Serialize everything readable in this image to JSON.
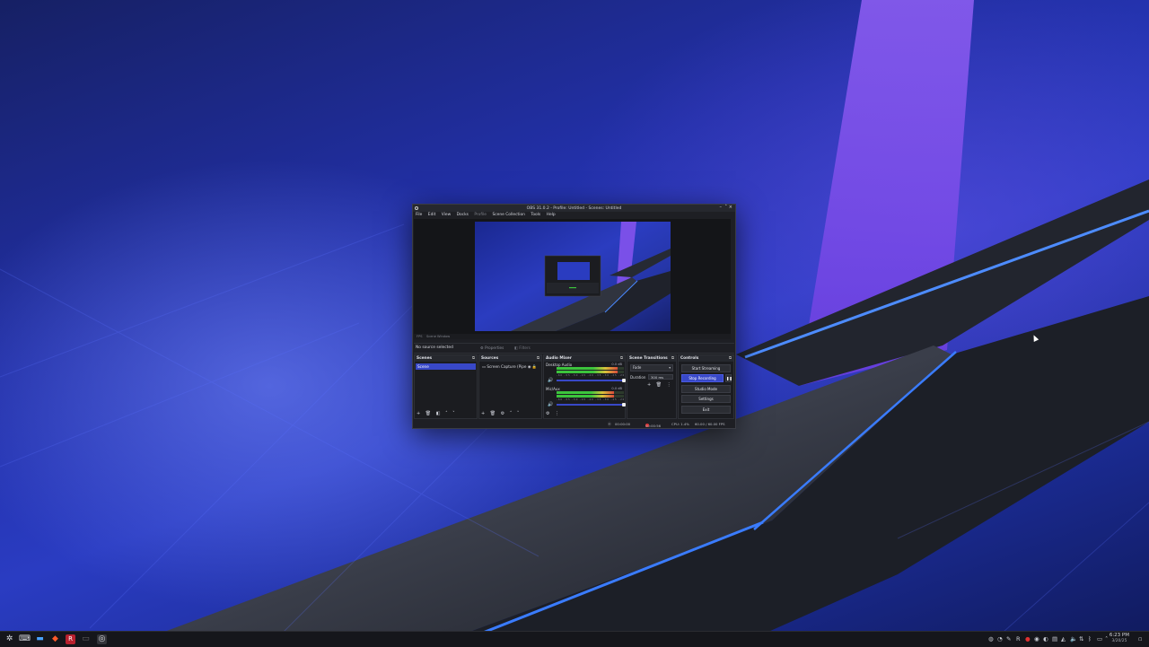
{
  "window": {
    "title": "OBS 31.0.2 - Profile: Untitled - Scenes: Untitled",
    "menu": [
      "File",
      "Edit",
      "View",
      "Docks",
      "Profile",
      "Scene Collection",
      "Tools",
      "Help"
    ]
  },
  "preview_bar": {
    "left": "FPS",
    "label": "Scene Window"
  },
  "source_bar": {
    "no_source": "No source selected",
    "properties": "Properties",
    "filters": "Filters"
  },
  "docks": {
    "scenes": {
      "title": "Scenes",
      "items": [
        "Scene"
      ]
    },
    "sources": {
      "title": "Sources",
      "items": [
        "Screen Capture (Pipe"
      ]
    },
    "mixer": {
      "title": "Audio Mixer",
      "channels": [
        {
          "name": "Desktop Audio",
          "db": "0.0 dB",
          "level": 0.9
        },
        {
          "name": "Mic/Aux",
          "db": "0.0 dB",
          "level": 0.85
        }
      ],
      "ticks": "-60 -55 -50 -45 -40 -35 -30 -25 -20 -15 -10 -5 0"
    },
    "transitions": {
      "title": "Scene Transitions",
      "selected": "Fade",
      "duration_label": "Duration",
      "duration_value": "300 ms"
    },
    "controls": {
      "title": "Controls",
      "start_streaming": "Start Streaming",
      "stop_recording": "Stop Recording",
      "studio_mode": "Studio Mode",
      "settings": "Settings",
      "exit": "Exit"
    }
  },
  "status": {
    "stream_time": "00:00:00",
    "rec_time": "00:00:56",
    "cpu": "CPU: 1.4%",
    "fps": "60.00 / 60.00 FPS"
  },
  "taskbar": {
    "time": "6:23 PM",
    "date": "3/20/25"
  },
  "colors": {
    "accent": "#3848c8",
    "recording": "#e03030"
  }
}
